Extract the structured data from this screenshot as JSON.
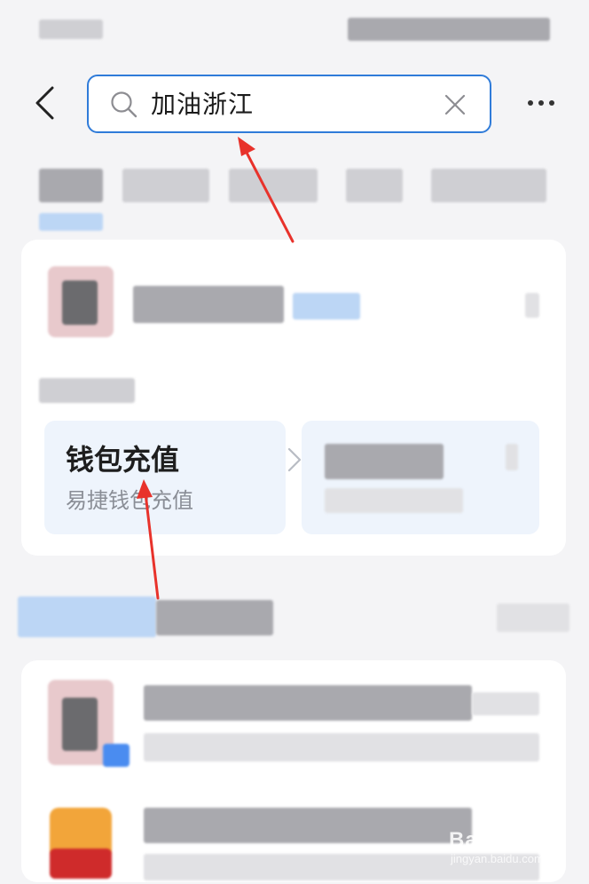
{
  "header": {
    "search_query": "加油浙江",
    "back_icon": "chevron-left-icon",
    "search_icon": "search-icon",
    "clear_icon": "close-icon",
    "more_icon": "more-horizontal-icon"
  },
  "service_tile": {
    "title": "钱包充值",
    "subtitle": "易捷钱包充值",
    "chevron_icon": "chevron-right-icon"
  },
  "watermark": {
    "logo": "Bai⊙经验",
    "url": "jingyan.baidu.com"
  },
  "colors": {
    "accent": "#2f7bd9",
    "arrow": "#e8322b",
    "tile_bg": "#eef4fc"
  }
}
